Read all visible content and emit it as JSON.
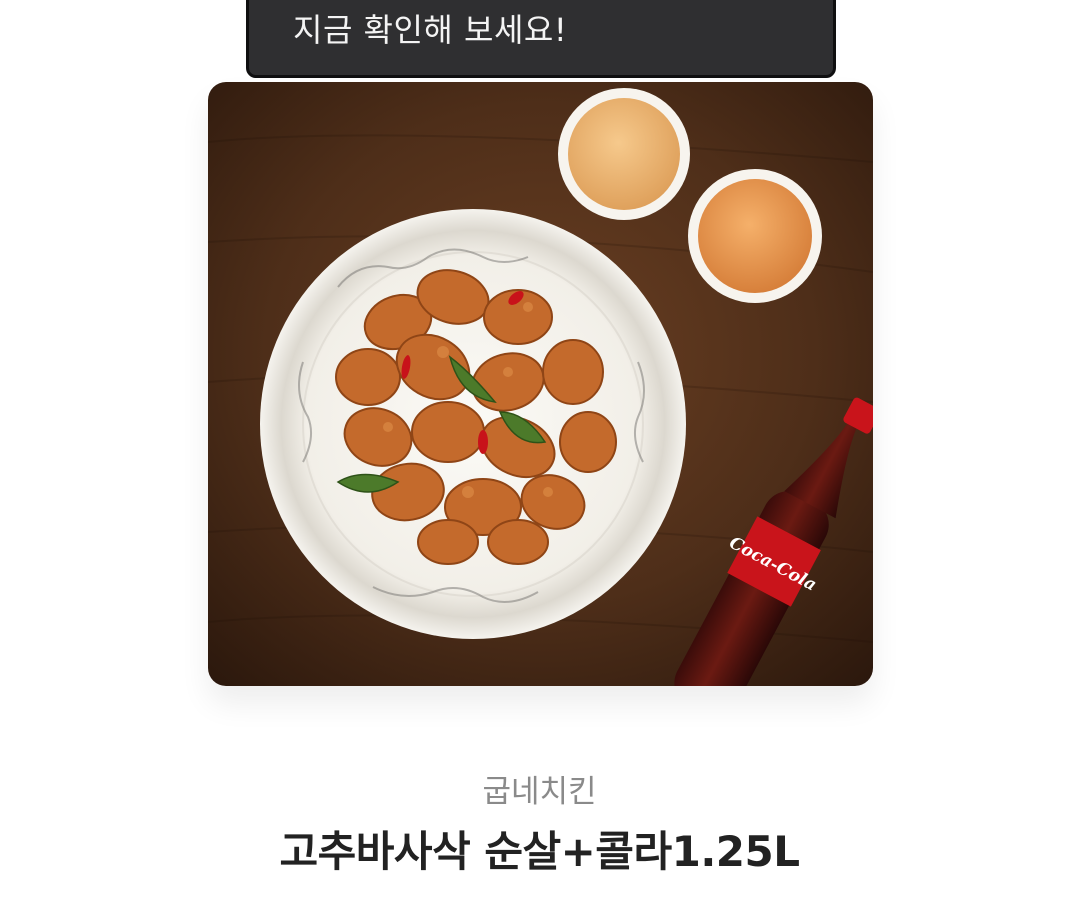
{
  "tooltip": {
    "text": "지금 확인해 보세요!"
  },
  "product": {
    "brand": "굽네치킨",
    "name": "고추바사삭 순살+콜라1.25L",
    "image_alt": "고추바사삭 순살 치킨과 콜라 1.25L",
    "bottle_label": "Coca-Cola"
  },
  "colors": {
    "tooltip_bg": "#2f2f31",
    "brand_text": "#8a8a8a",
    "title_text": "#222222",
    "table_wood": "#4a2c19"
  }
}
